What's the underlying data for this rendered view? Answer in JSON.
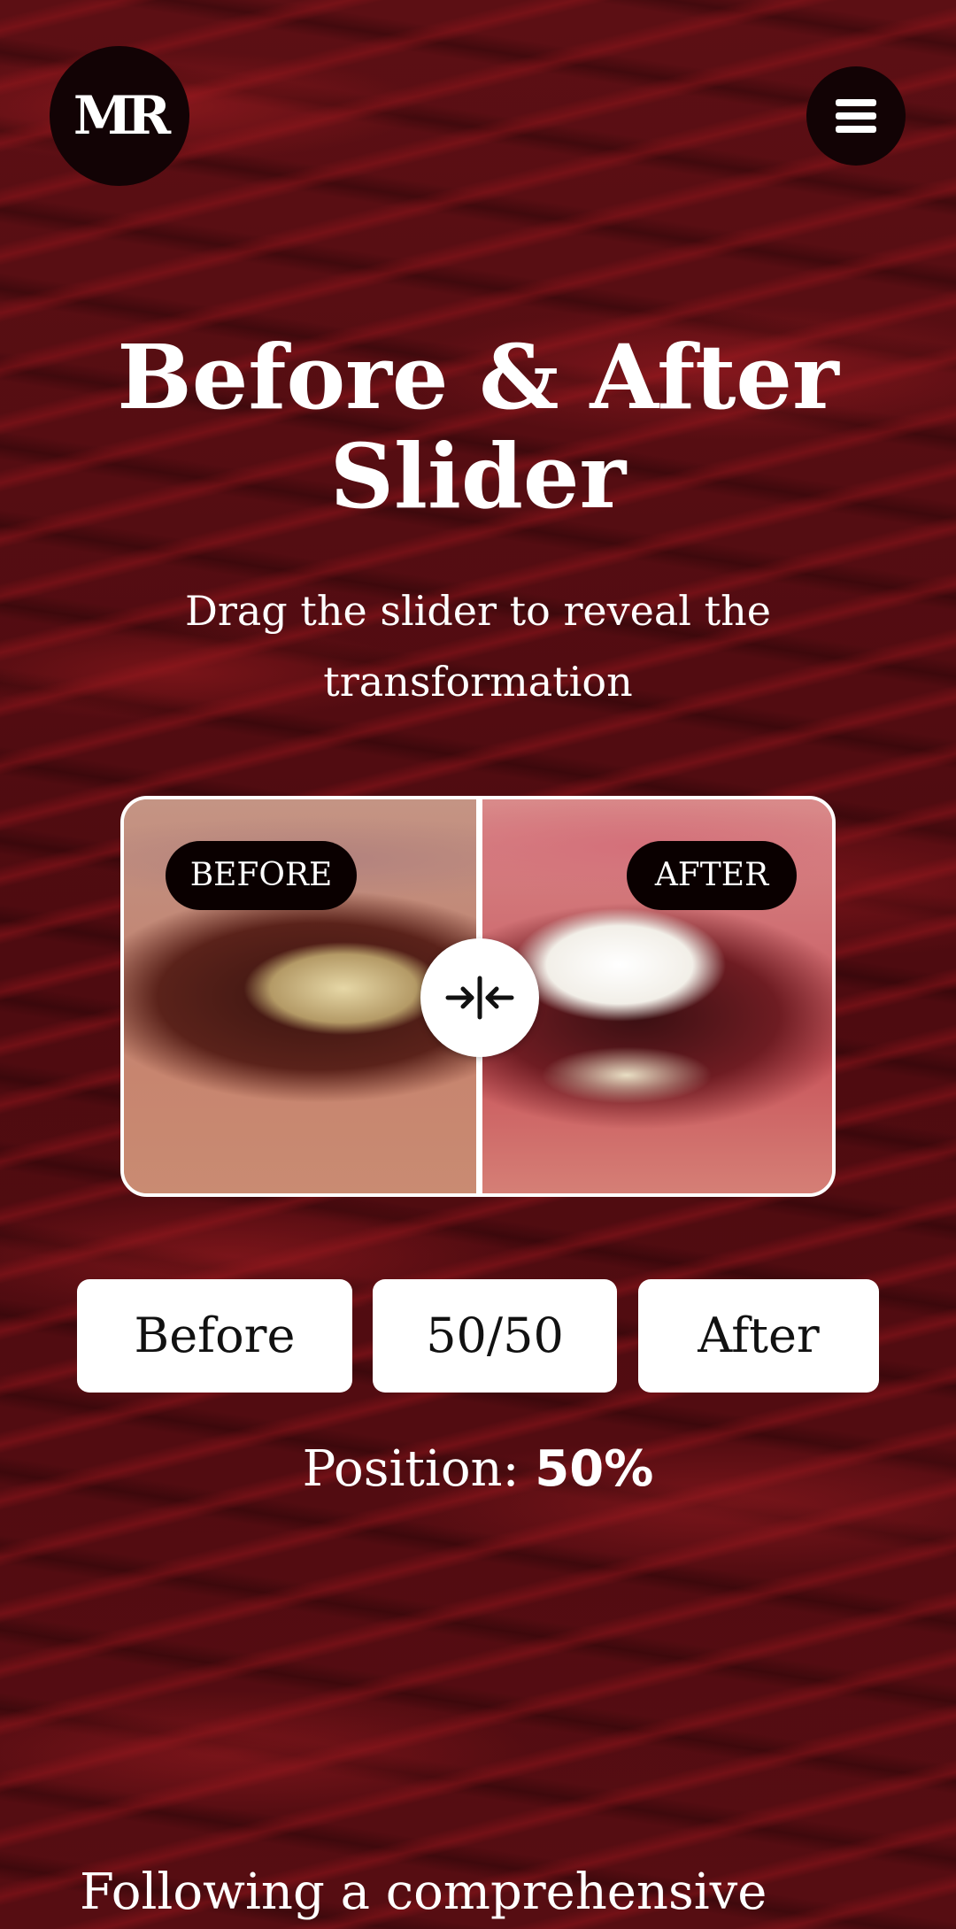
{
  "header": {
    "logo_text": "MR",
    "menu_icon": "hamburger-menu-icon"
  },
  "hero": {
    "title": "Before & After Slider",
    "subtitle": "Drag the slider to reveal the transformation"
  },
  "slider": {
    "before_label": "BEFORE",
    "after_label": "AFTER",
    "handle_icon": "compare-arrows-icon",
    "position_percent": 50
  },
  "controls": {
    "before_label": "Before",
    "split_label": "50/50",
    "after_label": "After"
  },
  "position": {
    "label": "Position:",
    "value": "50%"
  },
  "content": {
    "paragraph": "Following a comprehensive"
  },
  "colors": {
    "background": "#4a0a0e",
    "accent_texture": "#a81e23",
    "pill": "#0a0000",
    "button_bg": "#ffffff"
  }
}
